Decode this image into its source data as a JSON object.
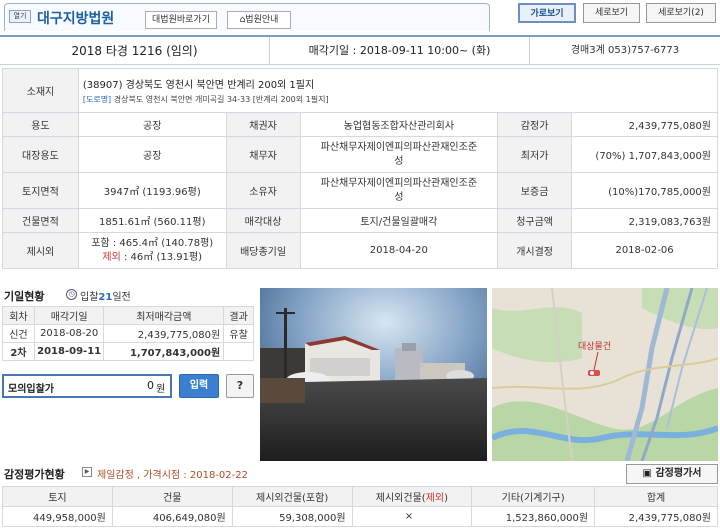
{
  "header": {
    "view_badge": "열기",
    "court_name": "대구지방법원",
    "court_link": "대법원바로가기",
    "court_guide": "법원안내",
    "toggle_horizontal": "가로보기",
    "toggle_vertical": "세로보기",
    "toggle_vertical2": "세로보기(2)"
  },
  "info": {
    "case_no": "2018 타경 1216 (임의)",
    "sale_date": "매각기일 : 2018-09-11 10:00~ (화)",
    "contact": "경매3계 053)757-6773"
  },
  "property": {
    "location_label": "소재지",
    "location": "(38907) 경상북도 영천시 북안면 반계리 200외 1필지",
    "road_tag": "[도로명]",
    "road_address": "경상북도 영천시 북안면 개미곡길 34-33 [반계리 200외 1필지]",
    "rows": [
      {
        "l1": "용도",
        "v1": "공장",
        "l2": "채권자",
        "v2": "농업협동조합자산관리회사",
        "l3": "감정가",
        "v3": "2,439,775,080원"
      },
      {
        "l1": "대장용도",
        "v1": "공장",
        "l2": "채무자",
        "v2": "파산채무자제이엔피의파산관재인조준성",
        "l3": "최저가",
        "v3_pct": "(70%)",
        "v3": "1,707,843,000원"
      },
      {
        "l1": "토지면적",
        "v1": "3947㎡ (1193.96평)",
        "l2": "소유자",
        "v2": "파산채무자제이엔피의파산관재인조준성",
        "l3": "보증금",
        "v3": "(10%)170,785,000원"
      },
      {
        "l1": "건물면적",
        "v1": "1851.61㎡ (560.11평)",
        "l2": "매각대상",
        "v2": "토지/건물일괄매각",
        "l3": "청구금액",
        "v3": "2,319,083,763원"
      }
    ],
    "extra": {
      "label": "제시외",
      "incl": "포함 : 465.4㎡ (140.78평)",
      "excl_tag": "제외",
      "excl": " : 46㎡ (13.91평)",
      "l2": "배당종기일",
      "v2": "2018-04-20",
      "l3": "개시결정",
      "v3": "2018-02-06"
    }
  },
  "history": {
    "title": "기일현황",
    "dday_pre": "입찰",
    "dday_num": "21",
    "dday_post": "일전",
    "headers": [
      "회차",
      "매각기일",
      "최저매각금액",
      "결과"
    ],
    "rows": [
      {
        "round": "신건",
        "date": "2018-08-20",
        "amount": "2,439,775,080원",
        "result": "유찰"
      },
      {
        "round": "2차",
        "date": "2018-09-11",
        "amount": "1,707,843,000원",
        "result": ""
      }
    ]
  },
  "mock_bid": {
    "label": "모의입찰가",
    "value": "0",
    "unit": "원",
    "input_button": "입력",
    "help_button": "?"
  },
  "map": {
    "label": "대상물건"
  },
  "appraisal": {
    "title": "감정평가현황",
    "sub": "제일감정 , 가격시점 : 2018-02-22",
    "doc_button": "감정평가서",
    "headers": [
      "토지",
      "건물",
      "제시외건물(포함)",
      "제시외건물(제외)",
      "기타(기계기구)",
      "합계"
    ],
    "excl_tag": "제외",
    "values": [
      "449,958,000원",
      "406,649,080원",
      "59,308,000원",
      "×",
      "1,523,860,000원",
      "2,439,775,080원"
    ]
  }
}
